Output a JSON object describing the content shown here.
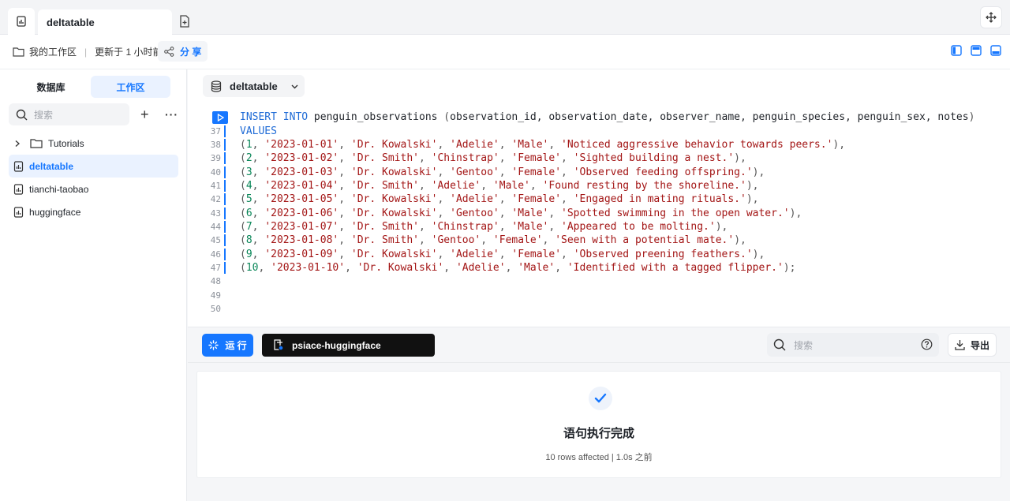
{
  "tabs": {
    "active_label": "deltatable"
  },
  "toolbar": {
    "workspace": "我的工作区",
    "separator": "|",
    "updated": "更新于 1 小时前",
    "share": "分 享"
  },
  "sidebar": {
    "tab_database": "数据库",
    "tab_workspace": "工作区",
    "search_placeholder": "搜索",
    "items": [
      {
        "label": "Tutorials",
        "type": "folder"
      },
      {
        "label": "deltatable",
        "type": "file",
        "active": true
      },
      {
        "label": "tianchi-taobao",
        "type": "file"
      },
      {
        "label": "huggingface",
        "type": "file"
      }
    ]
  },
  "editor": {
    "database": "deltatable",
    "lines": [
      {
        "n": "",
        "tokens": [
          [
            "kw",
            "INSERT"
          ],
          [
            "plain",
            " "
          ],
          [
            "kw",
            "INTO"
          ],
          [
            "plain",
            " penguin_observations "
          ],
          [
            "punc",
            "("
          ],
          [
            "plain",
            "observation_id, observation_date, observer_name, penguin_species, penguin_sex, notes"
          ],
          [
            "punc",
            ")"
          ]
        ]
      },
      {
        "n": "37",
        "tokens": [
          [
            "kw",
            "VALUES"
          ]
        ]
      },
      {
        "n": "38",
        "tokens": [
          [
            "punc",
            "("
          ],
          [
            "num",
            "1"
          ],
          [
            "punc",
            ", "
          ],
          [
            "str",
            "'2023-01-01'"
          ],
          [
            "punc",
            ", "
          ],
          [
            "str",
            "'Dr. Kowalski'"
          ],
          [
            "punc",
            ", "
          ],
          [
            "str",
            "'Adelie'"
          ],
          [
            "punc",
            ", "
          ],
          [
            "str",
            "'Male'"
          ],
          [
            "punc",
            ", "
          ],
          [
            "str",
            "'Noticed aggressive behavior towards peers.'"
          ],
          [
            "punc",
            "),"
          ]
        ]
      },
      {
        "n": "39",
        "tokens": [
          [
            "punc",
            "("
          ],
          [
            "num",
            "2"
          ],
          [
            "punc",
            ", "
          ],
          [
            "str",
            "'2023-01-02'"
          ],
          [
            "punc",
            ", "
          ],
          [
            "str",
            "'Dr. Smith'"
          ],
          [
            "punc",
            ", "
          ],
          [
            "str",
            "'Chinstrap'"
          ],
          [
            "punc",
            ", "
          ],
          [
            "str",
            "'Female'"
          ],
          [
            "punc",
            ", "
          ],
          [
            "str",
            "'Sighted building a nest.'"
          ],
          [
            "punc",
            "),"
          ]
        ]
      },
      {
        "n": "40",
        "tokens": [
          [
            "punc",
            "("
          ],
          [
            "num",
            "3"
          ],
          [
            "punc",
            ", "
          ],
          [
            "str",
            "'2023-01-03'"
          ],
          [
            "punc",
            ", "
          ],
          [
            "str",
            "'Dr. Kowalski'"
          ],
          [
            "punc",
            ", "
          ],
          [
            "str",
            "'Gentoo'"
          ],
          [
            "punc",
            ", "
          ],
          [
            "str",
            "'Female'"
          ],
          [
            "punc",
            ", "
          ],
          [
            "str",
            "'Observed feeding offspring.'"
          ],
          [
            "punc",
            "),"
          ]
        ]
      },
      {
        "n": "41",
        "tokens": [
          [
            "punc",
            "("
          ],
          [
            "num",
            "4"
          ],
          [
            "punc",
            ", "
          ],
          [
            "str",
            "'2023-01-04'"
          ],
          [
            "punc",
            ", "
          ],
          [
            "str",
            "'Dr. Smith'"
          ],
          [
            "punc",
            ", "
          ],
          [
            "str",
            "'Adelie'"
          ],
          [
            "punc",
            ", "
          ],
          [
            "str",
            "'Male'"
          ],
          [
            "punc",
            ", "
          ],
          [
            "str",
            "'Found resting by the shoreline.'"
          ],
          [
            "punc",
            "),"
          ]
        ]
      },
      {
        "n": "42",
        "tokens": [
          [
            "punc",
            "("
          ],
          [
            "num",
            "5"
          ],
          [
            "punc",
            ", "
          ],
          [
            "str",
            "'2023-01-05'"
          ],
          [
            "punc",
            ", "
          ],
          [
            "str",
            "'Dr. Kowalski'"
          ],
          [
            "punc",
            ", "
          ],
          [
            "str",
            "'Adelie'"
          ],
          [
            "punc",
            ", "
          ],
          [
            "str",
            "'Female'"
          ],
          [
            "punc",
            ", "
          ],
          [
            "str",
            "'Engaged in mating rituals.'"
          ],
          [
            "punc",
            "),"
          ]
        ]
      },
      {
        "n": "43",
        "tokens": [
          [
            "punc",
            "("
          ],
          [
            "num",
            "6"
          ],
          [
            "punc",
            ", "
          ],
          [
            "str",
            "'2023-01-06'"
          ],
          [
            "punc",
            ", "
          ],
          [
            "str",
            "'Dr. Kowalski'"
          ],
          [
            "punc",
            ", "
          ],
          [
            "str",
            "'Gentoo'"
          ],
          [
            "punc",
            ", "
          ],
          [
            "str",
            "'Male'"
          ],
          [
            "punc",
            ", "
          ],
          [
            "str",
            "'Spotted swimming in the open water.'"
          ],
          [
            "punc",
            "),"
          ]
        ]
      },
      {
        "n": "44",
        "tokens": [
          [
            "punc",
            "("
          ],
          [
            "num",
            "7"
          ],
          [
            "punc",
            ", "
          ],
          [
            "str",
            "'2023-01-07'"
          ],
          [
            "punc",
            ", "
          ],
          [
            "str",
            "'Dr. Smith'"
          ],
          [
            "punc",
            ", "
          ],
          [
            "str",
            "'Chinstrap'"
          ],
          [
            "punc",
            ", "
          ],
          [
            "str",
            "'Male'"
          ],
          [
            "punc",
            ", "
          ],
          [
            "str",
            "'Appeared to be molting.'"
          ],
          [
            "punc",
            "),"
          ]
        ]
      },
      {
        "n": "45",
        "tokens": [
          [
            "punc",
            "("
          ],
          [
            "num",
            "8"
          ],
          [
            "punc",
            ", "
          ],
          [
            "str",
            "'2023-01-08'"
          ],
          [
            "punc",
            ", "
          ],
          [
            "str",
            "'Dr. Smith'"
          ],
          [
            "punc",
            ", "
          ],
          [
            "str",
            "'Gentoo'"
          ],
          [
            "punc",
            ", "
          ],
          [
            "str",
            "'Female'"
          ],
          [
            "punc",
            ", "
          ],
          [
            "str",
            "'Seen with a potential mate.'"
          ],
          [
            "punc",
            "),"
          ]
        ]
      },
      {
        "n": "46",
        "tokens": [
          [
            "punc",
            "("
          ],
          [
            "num",
            "9"
          ],
          [
            "punc",
            ", "
          ],
          [
            "str",
            "'2023-01-09'"
          ],
          [
            "punc",
            ", "
          ],
          [
            "str",
            "'Dr. Kowalski'"
          ],
          [
            "punc",
            ", "
          ],
          [
            "str",
            "'Adelie'"
          ],
          [
            "punc",
            ", "
          ],
          [
            "str",
            "'Female'"
          ],
          [
            "punc",
            ", "
          ],
          [
            "str",
            "'Observed preening feathers.'"
          ],
          [
            "punc",
            "),"
          ]
        ]
      },
      {
        "n": "47",
        "tokens": [
          [
            "punc",
            "("
          ],
          [
            "num",
            "10"
          ],
          [
            "punc",
            ", "
          ],
          [
            "str",
            "'2023-01-10'"
          ],
          [
            "punc",
            ", "
          ],
          [
            "str",
            "'Dr. Kowalski'"
          ],
          [
            "punc",
            ", "
          ],
          [
            "str",
            "'Adelie'"
          ],
          [
            "punc",
            ", "
          ],
          [
            "str",
            "'Male'"
          ],
          [
            "punc",
            ", "
          ],
          [
            "str",
            "'Identified with a tagged flipper.'"
          ],
          [
            "punc",
            ");"
          ]
        ]
      },
      {
        "n": "48",
        "tokens": []
      },
      {
        "n": "49",
        "tokens": []
      },
      {
        "n": "50",
        "tokens": []
      }
    ]
  },
  "runbar": {
    "run_label": "运 行",
    "connection": "psiace-huggingface",
    "search_placeholder": "搜索",
    "export_label": "导出"
  },
  "result": {
    "title": "语句执行完成",
    "subtitle": "10 rows affected | 1.0s 之前"
  },
  "colors": {
    "accent": "#1677ff",
    "keyword": "#1f6bd6",
    "string": "#a31515",
    "number": "#098658"
  }
}
